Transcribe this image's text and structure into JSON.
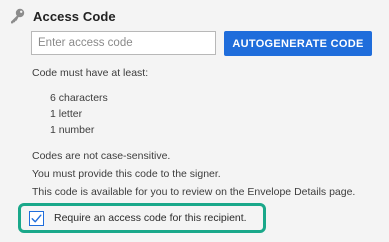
{
  "section": {
    "title": "Access Code",
    "icon": "key-icon"
  },
  "access_code_input": {
    "value": "",
    "placeholder": "Enter access code"
  },
  "autogenerate_button": {
    "label": "AUTOGENERATE CODE"
  },
  "requirements": {
    "label": "Code must have at least:",
    "items": [
      "6 characters",
      "1 letter",
      "1 number"
    ]
  },
  "notes": [
    "Codes are not case-sensitive.",
    "You must provide this code to the signer.",
    "This code is available for you to review on the Envelope Details page."
  ],
  "require_checkbox": {
    "label": "Require an access code for this recipient.",
    "checked": true
  },
  "colors": {
    "accent": "#1f6ddb",
    "highlight": "#1aa88a",
    "background": "#f4f4f4"
  }
}
